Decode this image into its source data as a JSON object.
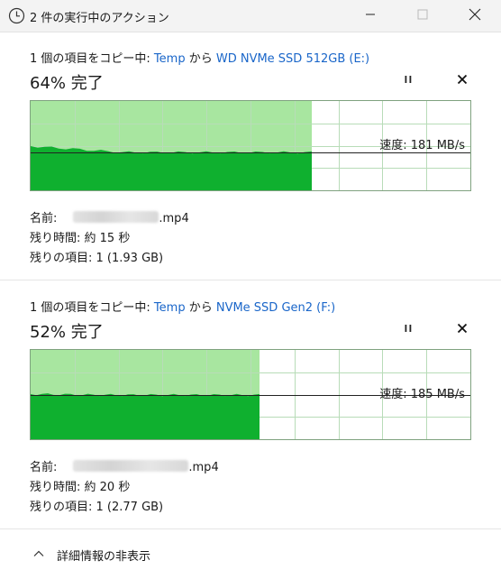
{
  "window": {
    "title": "2 件の実行中のアクション",
    "icons": {
      "app": "clock-icon",
      "minimize": "minimize-icon",
      "maximize": "maximize-icon",
      "close": "close-icon"
    }
  },
  "operations": [
    {
      "header_prefix": "1 個の項目をコピー中: ",
      "source": "Temp",
      "mid": " から ",
      "destination": "WD NVMe SSD 512GB (E:)",
      "percent_text": "64% 完了",
      "progress": 0.64,
      "speed_text": "速度: 181 MB/s",
      "name_label": "名前:",
      "name_suffix": ".mp4",
      "time_text": "残り時間: 約 15 秒",
      "items_text": "残りの項目: 1 (1.93 GB)",
      "speed_level": 0.42,
      "initial_level": 0.5
    },
    {
      "header_prefix": "1 個の項目をコピー中: ",
      "source": "Temp",
      "mid": " から ",
      "destination": "NVMe SSD Gen2 (F:)",
      "percent_text": "52% 完了",
      "progress": 0.52,
      "speed_text": "速度: 185 MB/s",
      "name_label": "名前:",
      "name_suffix": ".mp4",
      "time_text": "残り時間: 約 20 秒",
      "items_text": "残りの項目: 1 (2.77 GB)",
      "speed_level": 0.5,
      "initial_level": 0.51
    }
  ],
  "footer": {
    "label": "詳細情報の非表示",
    "icon": "chevron-up-icon"
  },
  "colors": {
    "graph_light": "#a8e6a0",
    "graph_fill": "#0fb02f",
    "grid": "#b8dcb8",
    "link": "#1a66c9"
  }
}
